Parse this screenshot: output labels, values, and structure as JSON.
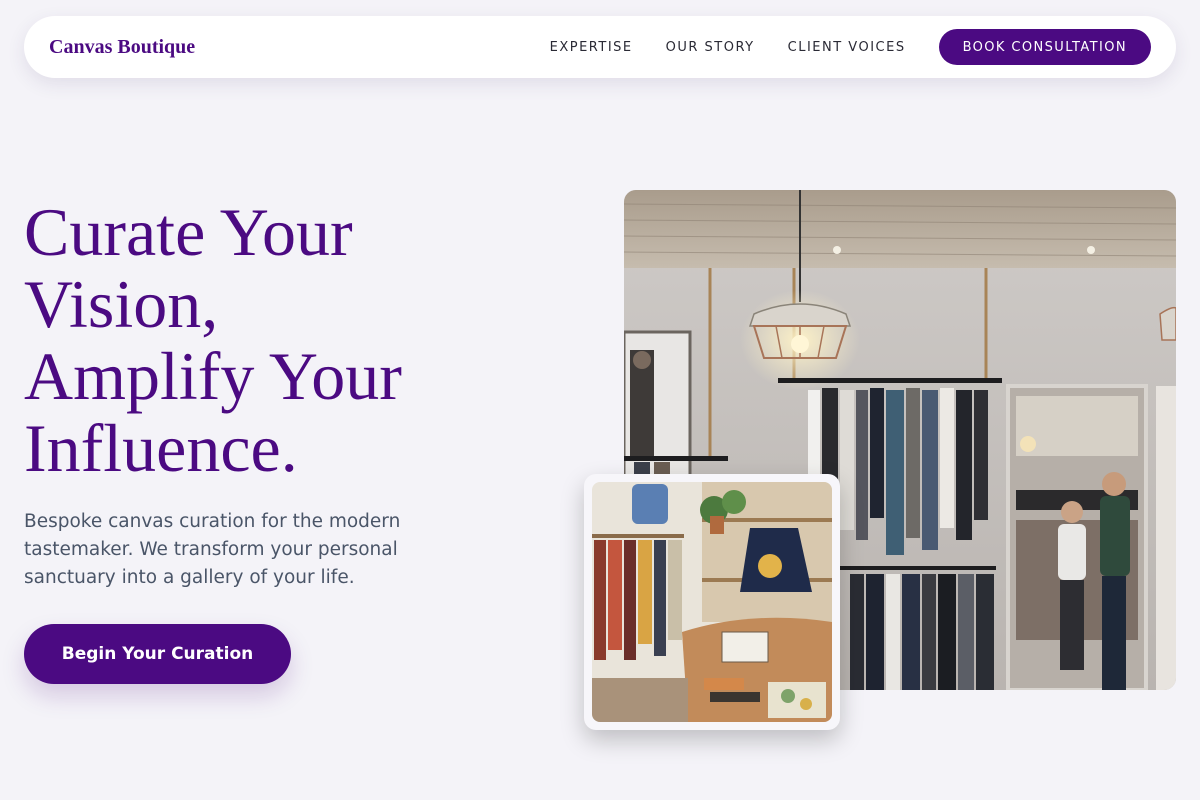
{
  "brand": "Canvas Boutique",
  "nav": {
    "links": [
      "EXPERTISE",
      "OUR STORY",
      "CLIENT VOICES"
    ],
    "cta": "BOOK CONSULTATION"
  },
  "hero": {
    "title_lines": [
      "Curate Your",
      "Vision,",
      "Amplify Your",
      "Influence."
    ],
    "subtitle_lines": [
      "Bespoke canvas curation for the modern",
      "tastemaker. We transform your personal",
      "sanctuary into a gallery of your life."
    ],
    "cta": "Begin Your Curation"
  },
  "images": {
    "main": "boutique-interior-photo",
    "inset": "boutique-shop-display-photo"
  },
  "colors": {
    "accent": "#4b0a82",
    "background": "#f4f3f8",
    "body_text": "#4a5568"
  }
}
